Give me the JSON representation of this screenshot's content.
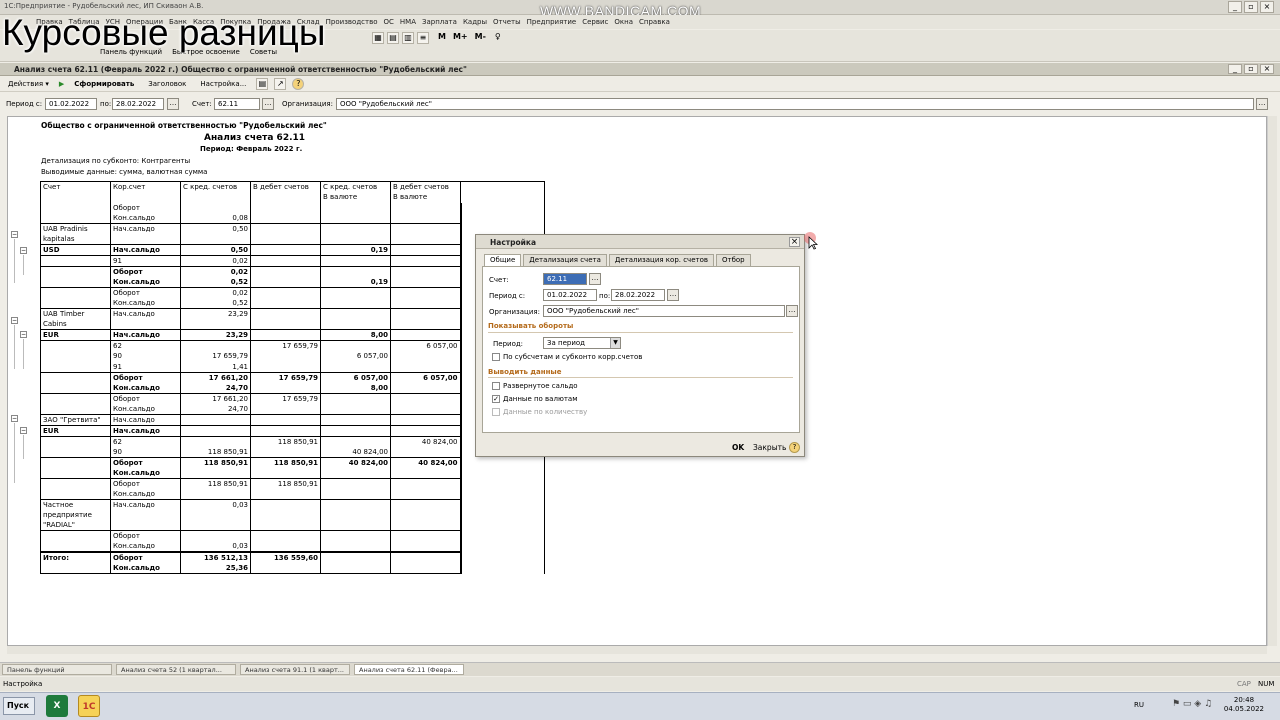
{
  "window": {
    "title": "1С:Предприятие - Рудобельский лес, ИП Скиваон А.В.",
    "min": "_",
    "max": "▫",
    "close": "×"
  },
  "watermark": "WWW.BANDICAM.COM",
  "overlay_title": "Курсовые разницы",
  "menu": [
    "Правка",
    "Таблица",
    "УСН",
    "Операции",
    "Банк",
    "Касса",
    "Покупка",
    "Продажа",
    "Склад",
    "Производство",
    "ОС",
    "НМА",
    "Зарплата",
    "Кадры",
    "Отчеты",
    "Предприятие",
    "Сервис",
    "Окна",
    "Справка"
  ],
  "toolbar_panel": {
    "functions": "Панель функций",
    "quick_open": "Быстрое освоение",
    "tips": "Советы"
  },
  "toolbar_marks": [
    "M",
    "M+",
    "M-"
  ],
  "doc_title": "Анализ счета 62.11 (Февраль 2022 г.) Общество с ограниченной ответственностью \"Рудобельский лес\"",
  "actions": {
    "actions": "Действия ▾",
    "generate": "Сформировать",
    "header": "Заголовок",
    "settings": "Настройка..."
  },
  "params": {
    "period_from_label": "Период с:",
    "period_from": "01.02.2022",
    "period_to_label": "по:",
    "period_to": "28.02.2022",
    "account_label": "Счет:",
    "account": "62.11",
    "org_label": "Организация:",
    "org": "ООО \"Рудобельский лес\""
  },
  "report": {
    "org": "Общество с ограниченной ответственностью \"Рудобельский лес\"",
    "title": "Анализ счета 62.11",
    "period": "Период: Февраль 2022 г.",
    "detail": "Детализация по  субконто: Контрагенты",
    "output": "Выводимые данные: сумма, валютная сумма",
    "headers": [
      "Счет",
      "Кор.счет",
      "С кред. счетов",
      "В дебет счетов",
      "С кред. счетов",
      "В дебет счетов"
    ],
    "subheaders": [
      "",
      "",
      "",
      "",
      "В валюте",
      "В валюте"
    ],
    "rows": [
      {
        "c": [
          "",
          "Оборот",
          "",
          "",
          "",
          ""
        ]
      },
      {
        "c": [
          "",
          "Кон.сальдо",
          "0,08",
          "",
          "",
          ""
        ]
      },
      {
        "c": [
          "UAB Pradinis",
          "Нач.сальдо",
          "0,50",
          "",
          "",
          ""
        ],
        "top": true
      },
      {
        "c": [
          "kapitalas",
          "",
          "",
          "",
          "",
          ""
        ]
      },
      {
        "c": [
          "USD",
          "Нач.сальдо",
          "0,50",
          "",
          "0,19",
          ""
        ],
        "top": true,
        "bold": true
      },
      {
        "c": [
          "",
          "91",
          "0,02",
          "",
          "",
          ""
        ],
        "top": true
      },
      {
        "c": [
          "",
          "Оборот",
          "0,02",
          "",
          "",
          ""
        ],
        "top": true,
        "bold": true
      },
      {
        "c": [
          "",
          "Кон.сальдо",
          "0,52",
          "",
          "0,19",
          ""
        ],
        "bold": true
      },
      {
        "c": [
          "",
          "Оборот",
          "0,02",
          "",
          "",
          ""
        ],
        "top": true
      },
      {
        "c": [
          "",
          "Кон.сальдо",
          "0,52",
          "",
          "",
          ""
        ]
      },
      {
        "c": [
          "UAB Timber",
          "Нач.сальдо",
          "23,29",
          "",
          "",
          ""
        ],
        "top": true
      },
      {
        "c": [
          "Cabins",
          "",
          "",
          "",
          "",
          ""
        ]
      },
      {
        "c": [
          "EUR",
          "Нач.сальдо",
          "23,29",
          "",
          "8,00",
          ""
        ],
        "top": true,
        "bold": true
      },
      {
        "c": [
          "",
          "62",
          "",
          "17 659,79",
          "",
          "6 057,00"
        ],
        "top": true
      },
      {
        "c": [
          "",
          "90",
          "17 659,79",
          "",
          "6 057,00",
          ""
        ]
      },
      {
        "c": [
          "",
          "91",
          "1,41",
          "",
          "",
          ""
        ]
      },
      {
        "c": [
          "",
          "Оборот",
          "17 661,20",
          "17 659,79",
          "6 057,00",
          "6 057,00"
        ],
        "top": true,
        "bold": true
      },
      {
        "c": [
          "",
          "Кон.сальдо",
          "24,70",
          "",
          "8,00",
          ""
        ],
        "bold": true
      },
      {
        "c": [
          "",
          "Оборот",
          "17 661,20",
          "17 659,79",
          "",
          ""
        ],
        "top": true
      },
      {
        "c": [
          "",
          "Кон.сальдо",
          "24,70",
          "",
          "",
          ""
        ]
      },
      {
        "c": [
          "ЗАО \"Гретвита\"",
          "Нач.сальдо",
          "",
          "",
          "",
          ""
        ],
        "top": true
      },
      {
        "c": [
          "EUR",
          "Нач.сальдо",
          "",
          "",
          "",
          ""
        ],
        "top": true,
        "bold": true
      },
      {
        "c": [
          "",
          "62",
          "",
          "118 850,91",
          "",
          "40 824,00"
        ],
        "top": true
      },
      {
        "c": [
          "",
          "90",
          "118 850,91",
          "",
          "40 824,00",
          ""
        ]
      },
      {
        "c": [
          "",
          "Оборот",
          "118 850,91",
          "118 850,91",
          "40 824,00",
          "40 824,00"
        ],
        "top": true,
        "bold": true
      },
      {
        "c": [
          "",
          "Кон.сальдо",
          "",
          "",
          "",
          ""
        ],
        "bold": true
      },
      {
        "c": [
          "",
          "Оборот",
          "118 850,91",
          "118 850,91",
          "",
          ""
        ],
        "top": true
      },
      {
        "c": [
          "",
          "Кон.сальдо",
          "",
          "",
          "",
          ""
        ]
      },
      {
        "c": [
          "Частное",
          "Нач.сальдо",
          "0,03",
          "",
          "",
          ""
        ],
        "top": true
      },
      {
        "c": [
          "предприятие",
          "",
          "",
          "",
          "",
          ""
        ]
      },
      {
        "c": [
          "\"RADIAL\"",
          "",
          "",
          "",
          "",
          ""
        ]
      },
      {
        "c": [
          "",
          "Оборот",
          "",
          "",
          "",
          ""
        ],
        "top": true
      },
      {
        "c": [
          "",
          "Кон.сальдо",
          "0,03",
          "",
          "",
          ""
        ]
      },
      {
        "c": [
          "Итого:",
          "Оборот",
          "136 512,13",
          "136 559,60",
          "",
          ""
        ],
        "thick": true,
        "bold": true
      },
      {
        "c": [
          "",
          "Кон.сальдо",
          "25,36",
          "",
          "",
          ""
        ],
        "bold": true
      }
    ]
  },
  "dialog": {
    "title": "Настройка",
    "tabs": [
      "Общие",
      "Детализация счета",
      "Детализация кор. счетов",
      "Отбор"
    ],
    "account_label": "Счет:",
    "account": "62.11",
    "period_label": "Период с:",
    "period_from": "01.02.2022",
    "period_to_label": "по:",
    "period_to": "28.02.2022",
    "org_label": "Организация:",
    "org": "ООО \"Рудобельский лес\"",
    "turnover_section": "Показывать обороты",
    "period2_label": "Период:",
    "period2": "За период",
    "subaccounts": "По субсчетам и субконто корр.счетов",
    "output_section": "Выводить данные",
    "expanded_balance": "Развернутое сальдо",
    "currency_data": "Данные по валютам",
    "quantity_data": "Данные по количеству",
    "ok": "OK",
    "close": "Закрыть",
    "help": "?"
  },
  "window_tabs": [
    "Панель функций",
    "Анализ счета 52 (1 квартал...",
    "Анализ счета 91.1 (1 кварт...",
    "Анализ счета 62.11 (Февра..."
  ],
  "status": {
    "left": "Настройка",
    "cap": "CAP",
    "num": "NUM"
  },
  "taskbar": {
    "start": "Пуск",
    "lang": "RU",
    "time": "20:48",
    "date": "04.05.2022"
  }
}
